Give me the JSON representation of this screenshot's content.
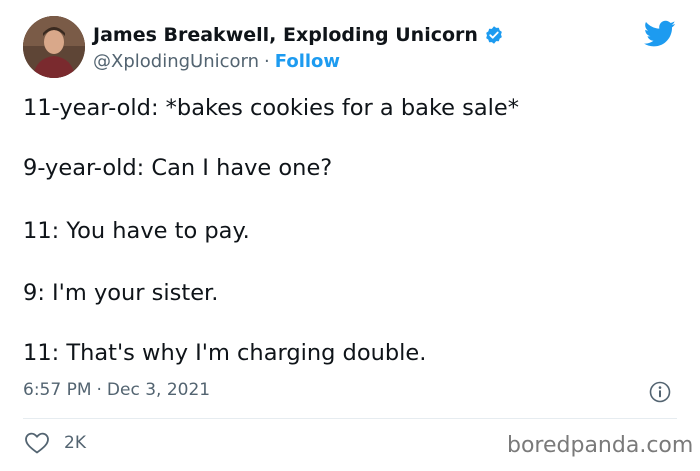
{
  "tweet": {
    "author": {
      "display_name": "James Breakwell, Exploding Unicorn",
      "handle": "@XplodingUnicorn",
      "separator": "·",
      "follow_label": "Follow"
    },
    "lines": [
      "11-year-old: *bakes cookies for a bake sale*",
      "9-year-old: Can I have one?",
      "11: You have to pay.",
      "9: I'm your sister.",
      "11: That's why I'm charging double."
    ],
    "time": "6:57 PM",
    "date_separator": "·",
    "date": "Dec 3, 2021",
    "likes": "2K"
  },
  "watermark": "boredpanda.com",
  "colors": {
    "accent": "#1d9bf0",
    "text": "#0f1419",
    "secondary": "#536471"
  },
  "icons": {
    "verified": "verified-badge-icon",
    "platform": "twitter-bird-icon",
    "info": "info-icon",
    "like": "heart-icon"
  }
}
